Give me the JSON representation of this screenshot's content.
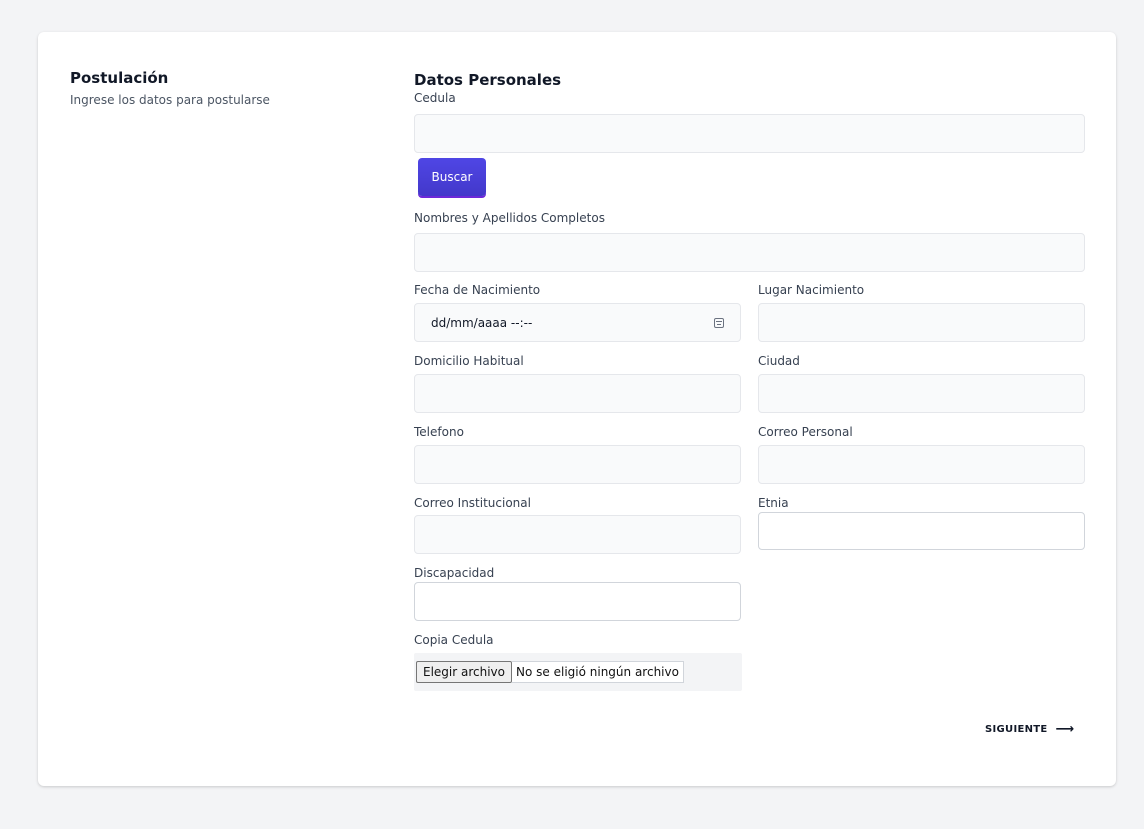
{
  "sidebar": {
    "title": "Postulación",
    "subtitle": "Ingrese los datos para postularse"
  },
  "form": {
    "section_title": "Datos Personales",
    "cedula": {
      "label": "Cedula",
      "value": ""
    },
    "search_button": "Buscar",
    "nombres": {
      "label": "Nombres y Apellidos Completos",
      "value": ""
    },
    "fecha_nacimiento": {
      "label": "Fecha de Nacimiento",
      "placeholder": "dd/mm/aaaa --:--",
      "icon": "calendar-icon"
    },
    "lugar_nacimiento": {
      "label": "Lugar Nacimiento",
      "value": ""
    },
    "domicilio": {
      "label": "Domicilio Habitual",
      "value": ""
    },
    "ciudad": {
      "label": "Ciudad",
      "value": ""
    },
    "telefono": {
      "label": "Telefono",
      "value": ""
    },
    "correo_personal": {
      "label": "Correo Personal",
      "value": ""
    },
    "correo_institucional": {
      "label": "Correo Institucional",
      "value": ""
    },
    "etnia": {
      "label": "Etnia",
      "value": ""
    },
    "discapacidad": {
      "label": "Discapacidad",
      "value": ""
    },
    "copia_cedula": {
      "label": "Copia Cedula",
      "button": "Elegir archivo",
      "status": "No se eligió ningún archivo"
    }
  },
  "footer": {
    "next_label": "SIGUIENTE",
    "next_icon": "arrow-right-icon"
  },
  "colors": {
    "accent": "#4f46e5",
    "input_bg": "#f9fafb",
    "page_bg": "#f3f4f6"
  }
}
